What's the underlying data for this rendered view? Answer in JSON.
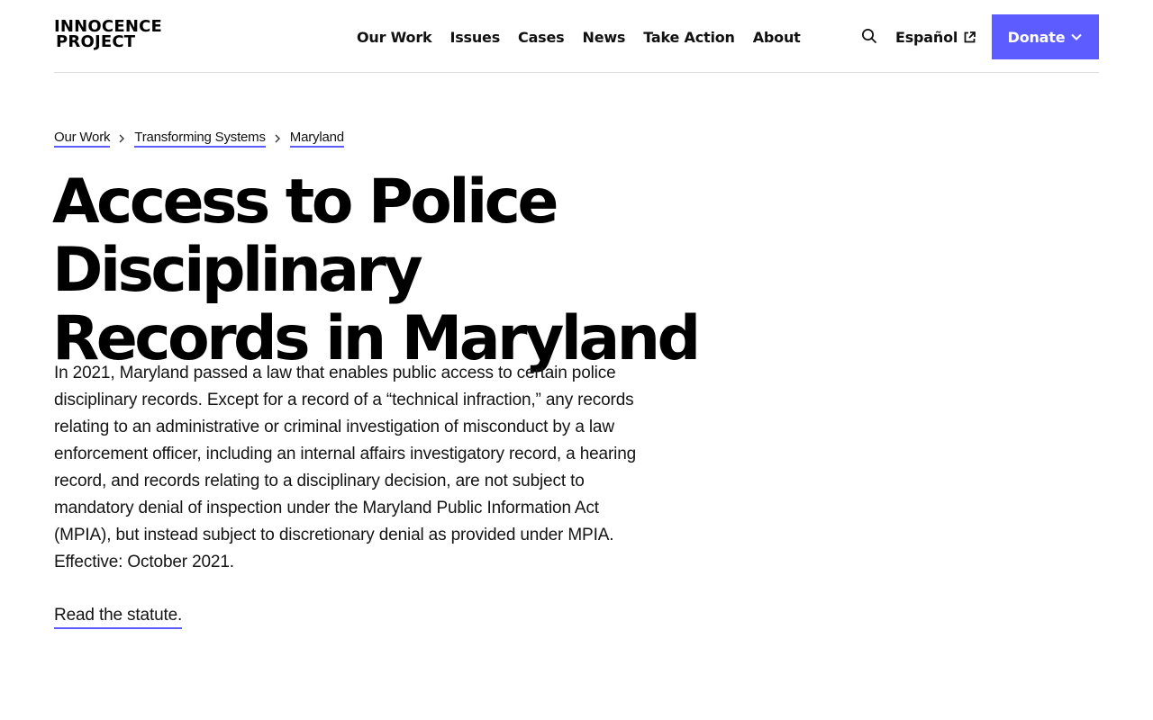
{
  "header": {
    "logo_line1": "INNOCENCE",
    "logo_line2": "PROJECT",
    "nav": [
      "Our Work",
      "Issues",
      "Cases",
      "News",
      "Take Action",
      "About"
    ],
    "language_label": "Español",
    "donate_label": "Donate",
    "accent_color": "#5c5cff"
  },
  "breadcrumb": [
    "Our Work",
    "Transforming Systems",
    "Maryland"
  ],
  "page": {
    "title_line1": "Access to Police Disciplinary",
    "title_line2": "Records in Maryland",
    "body": "In 2021, Maryland passed a law that enables public access to certain police disciplinary records. Except for a record of a “technical infraction,” any records relating to an administrative or criminal investigation of misconduct by a law enforcement officer, including an internal affairs investigatory record, a hearing record, and records relating to a disciplinary decision, are not subject to mandatory denial of inspection under the Maryland Public Information Act (MPIA), but instead subject to discretionary denial as provided under MPIA. Effective: October 2021.",
    "statute_link": "Read the statute."
  },
  "icons": {
    "search": "search-icon",
    "external": "external-link-icon",
    "dropdown": "chevron-down-icon",
    "breadcrumb_separator": "chevron-right-icon"
  }
}
